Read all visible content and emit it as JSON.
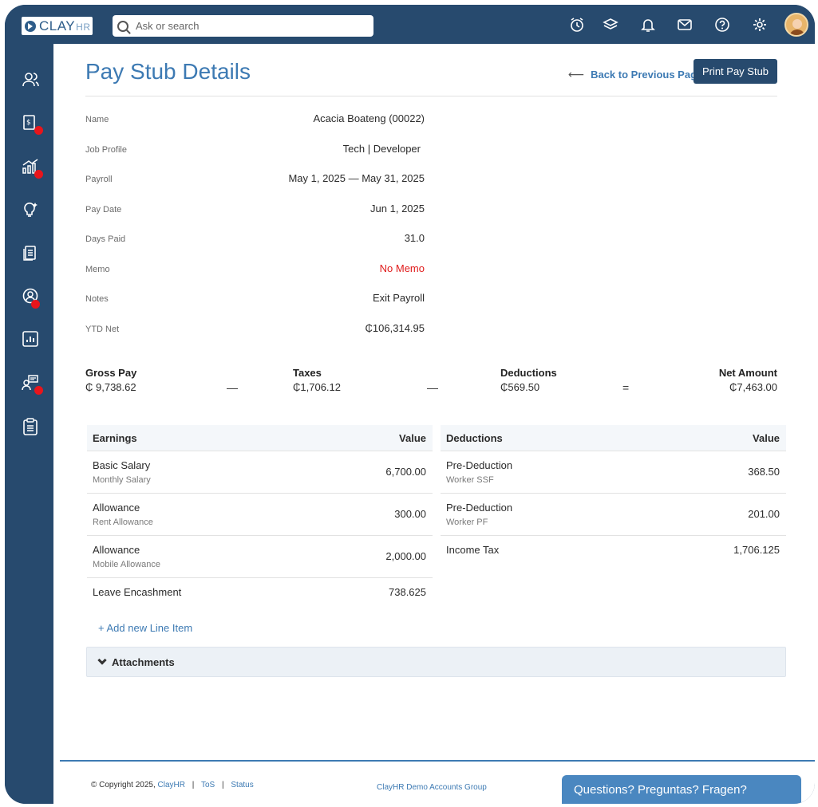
{
  "topbar": {
    "logo_text": "CLAY",
    "logo_suffix": "HR",
    "search_placeholder": "Ask or search",
    "icons": [
      "alarm-clock-icon",
      "layers-icon",
      "bell-icon",
      "mail-icon",
      "help-icon",
      "gear-icon"
    ]
  },
  "sidebar": {
    "items": [
      {
        "icon": "people-icon",
        "badge": false
      },
      {
        "icon": "payroll-icon",
        "badge": true
      },
      {
        "icon": "growth-chart-icon",
        "badge": true
      },
      {
        "icon": "lightbulb-icon",
        "badge": false
      },
      {
        "icon": "documents-icon",
        "badge": false
      },
      {
        "icon": "user-circle-icon",
        "badge": true
      },
      {
        "icon": "report-chart-icon",
        "badge": false
      },
      {
        "icon": "training-icon",
        "badge": true
      },
      {
        "icon": "clipboard-icon",
        "badge": false
      }
    ],
    "badge_color": "#e8151c"
  },
  "header": {
    "title": "Pay Stub Details",
    "back_label": "Back to Previous Page",
    "print_label": "Print Pay Stub"
  },
  "details": [
    {
      "label": "Name",
      "value": "Acacia Boateng  (00022)"
    },
    {
      "label": "Job Profile",
      "value": "Tech | Developer "
    },
    {
      "label": "Payroll",
      "value": "May 1, 2025 — May 31, 2025"
    },
    {
      "label": "Pay Date",
      "value": "Jun 1, 2025"
    },
    {
      "label": "Days Paid",
      "value": "31.0"
    },
    {
      "label": "Memo",
      "value": "No Memo"
    },
    {
      "label": "Notes",
      "value": "Exit Payroll"
    },
    {
      "label": "YTD Net",
      "value": "₵106,314.95"
    }
  ],
  "summary": {
    "gross_label": "Gross Pay",
    "gross_value": "₵ 9,738.62",
    "taxes_label": "Taxes",
    "taxes_value": "₵1,706.12",
    "deductions_label": "Deductions",
    "deductions_value": "₵569.50",
    "net_label": "Net Amount",
    "net_value": "₵7,463.00",
    "minus": "—",
    "equals": "="
  },
  "earnings": {
    "header_left": "Earnings",
    "header_right": "Value",
    "rows": [
      {
        "title": "Basic Salary",
        "sub": "Monthly Salary",
        "value": "6,700.00"
      },
      {
        "title": "Allowance",
        "sub": "Rent Allowance",
        "value": "300.00"
      },
      {
        "title": "Allowance",
        "sub": "Mobile Allowance",
        "value": "2,000.00"
      },
      {
        "title": "Leave Encashment",
        "sub": "",
        "value": "738.625"
      }
    ]
  },
  "deductions": {
    "header_left": "Deductions",
    "header_right": "Value",
    "rows": [
      {
        "title": "Pre-Deduction",
        "sub": "Worker SSF",
        "value": "368.50"
      },
      {
        "title": "Pre-Deduction",
        "sub": "Worker PF",
        "value": "201.00"
      },
      {
        "title": "Income Tax",
        "sub": "",
        "value": "1,706.125"
      }
    ]
  },
  "add_line_label": "+ Add new Line Item",
  "attachments_label": "Attachments",
  "footer": {
    "copyright": "© Copyright 2025,",
    "brand": "ClayHR",
    "tos": "ToS",
    "status": "Status",
    "separator": "|",
    "group": "ClayHR Demo Accounts Group",
    "help": "Questions? Preguntas? Fragen?"
  }
}
